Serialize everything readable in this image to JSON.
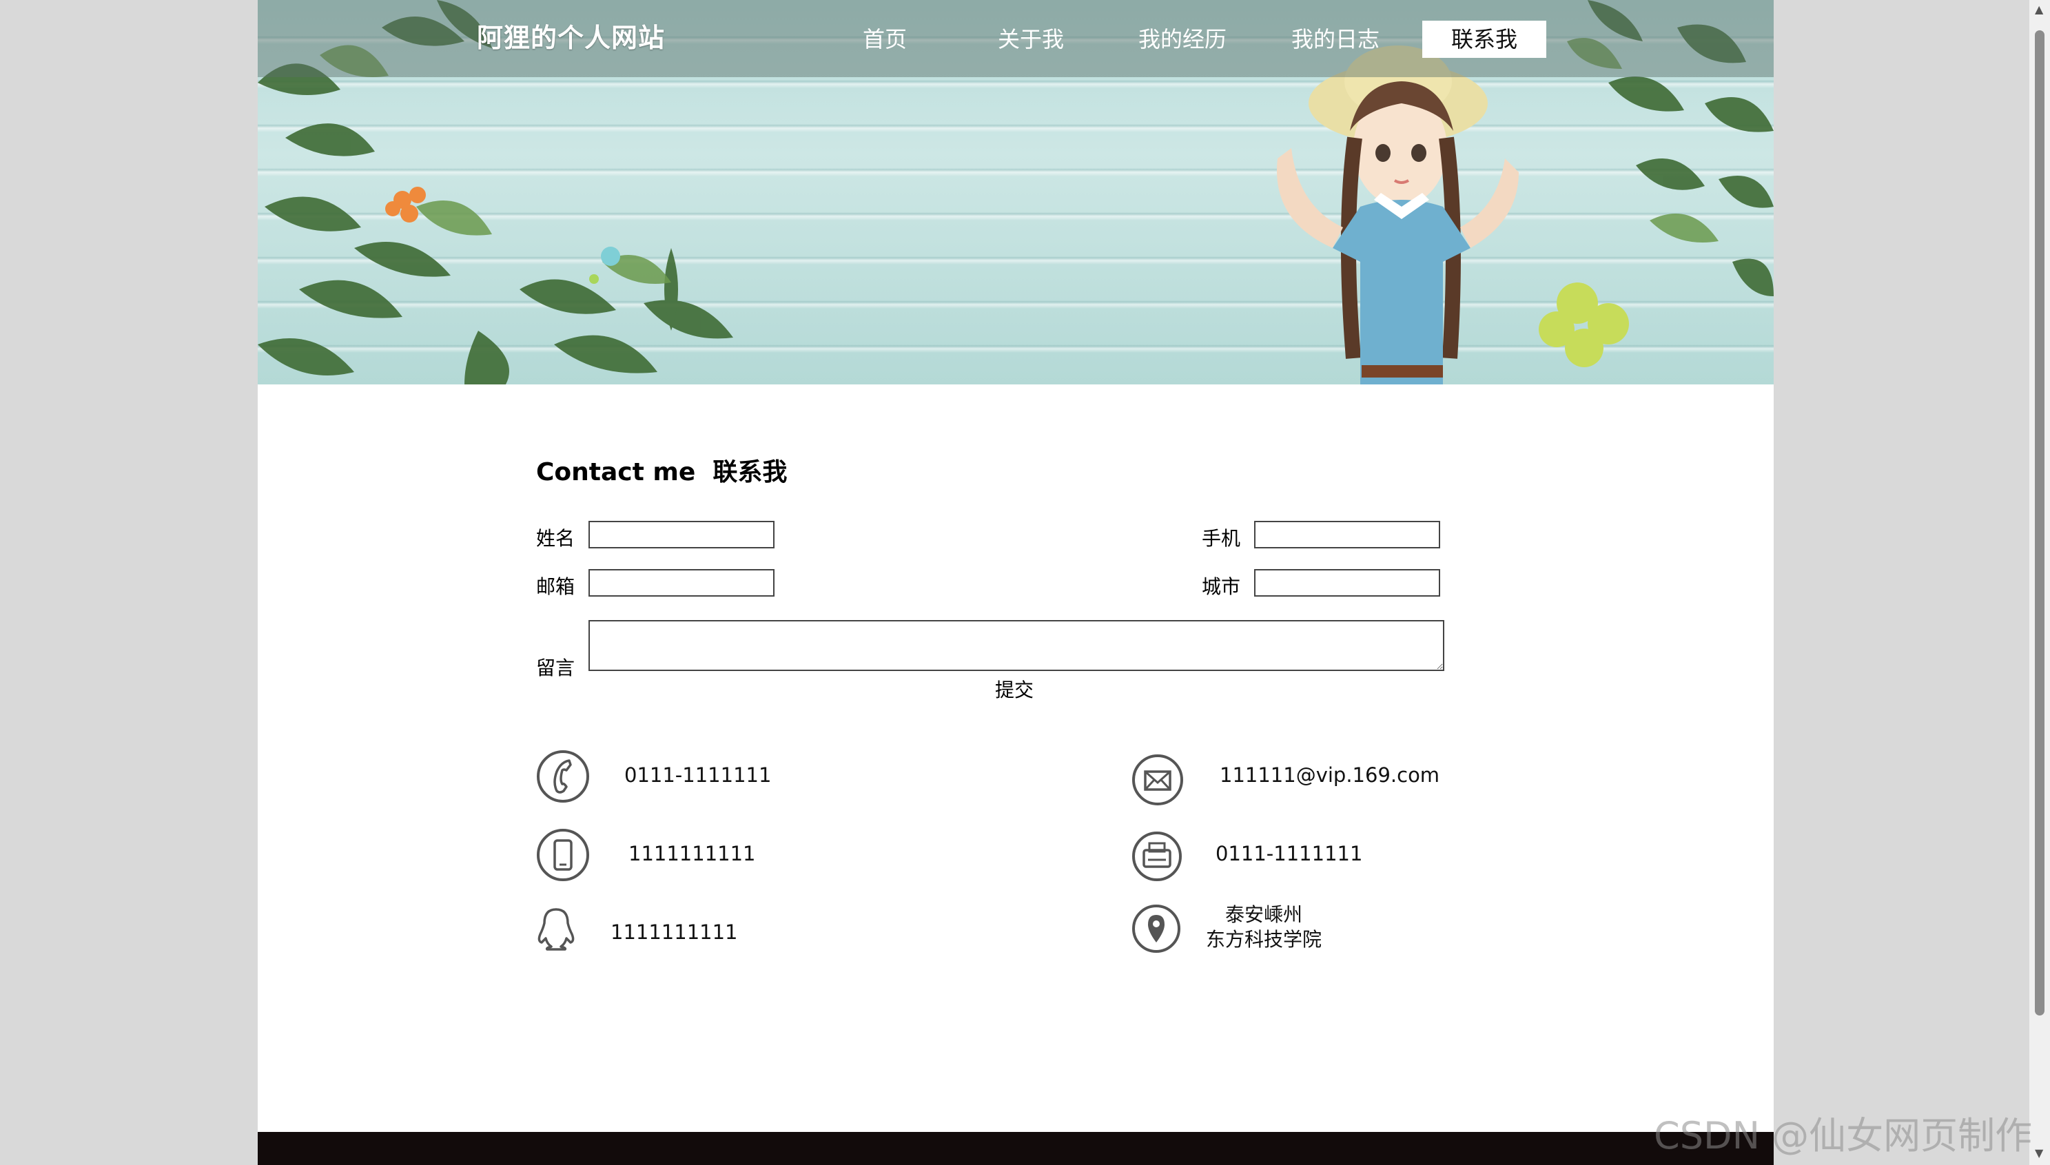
{
  "site": {
    "logo": "阿狸的个人网站"
  },
  "nav": {
    "items": [
      {
        "label": "首页"
      },
      {
        "label": "关于我"
      },
      {
        "label": "我的经历"
      },
      {
        "label": "我的日志"
      },
      {
        "label": "联系我",
        "active": true
      }
    ]
  },
  "contact": {
    "title": "Contact me  联系我",
    "form": {
      "name_label": "姓名",
      "phone_label": "手机",
      "email_label": "邮箱",
      "city_label": "城市",
      "message_label": "留言",
      "submit_label": "提交",
      "name_value": "",
      "phone_value": "",
      "email_value": "",
      "city_value": "",
      "message_value": ""
    },
    "info": {
      "telephone": "0111-1111111",
      "email": "111111@vip.169.com",
      "mobile": "1111111111",
      "fax": "0111-1111111",
      "qq": "1111111111",
      "address_line1": "泰安嵊州",
      "address_line2": "东方科技学院"
    }
  },
  "watermark": "CSDN @仙女网页制作",
  "icons": {
    "telephone": "telephone-icon",
    "mail": "mail-icon",
    "mobile": "mobile-phone-icon",
    "fax": "fax-icon",
    "qq": "qq-penguin-icon",
    "location": "location-pin-icon"
  },
  "colors": {
    "banner_teal": "#b8dcda",
    "footer": "#120b0b",
    "icon_stroke": "#555555"
  }
}
